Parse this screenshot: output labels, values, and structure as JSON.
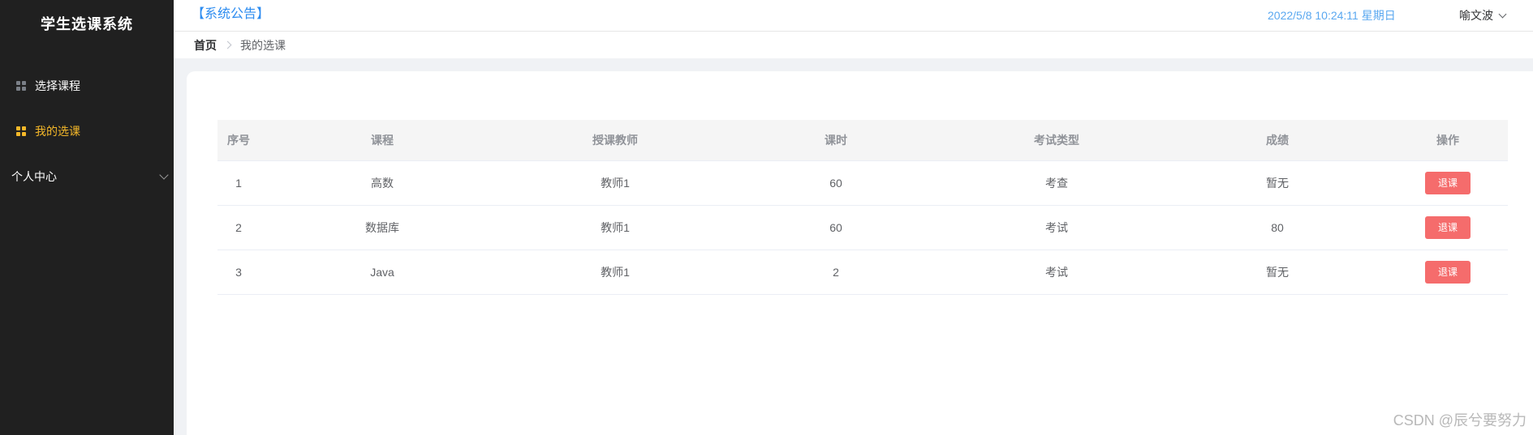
{
  "app_title": "学生选课系统",
  "sidebar": {
    "items": [
      {
        "label": "选择课程",
        "icon": "grid-icon"
      },
      {
        "label": "我的选课",
        "icon": "grid-icon",
        "active": true
      },
      {
        "label": "个人中心",
        "icon": "chevron-down-icon"
      }
    ]
  },
  "header": {
    "notice": "【系统公告】",
    "datetime": "2022/5/8 10:24:11 星期日",
    "user": "喻文波"
  },
  "breadcrumb": {
    "home": "首页",
    "current": "我的选课"
  },
  "table": {
    "columns": [
      "序号",
      "课程",
      "授课教师",
      "课时",
      "考试类型",
      "成绩",
      "操作"
    ],
    "rows": [
      {
        "idx": "1",
        "course": "高数",
        "teacher": "教师1",
        "hours": "60",
        "exam": "考查",
        "score": "暂无",
        "action": "退课"
      },
      {
        "idx": "2",
        "course": "数据库",
        "teacher": "教师1",
        "hours": "60",
        "exam": "考试",
        "score": "80",
        "action": "退课"
      },
      {
        "idx": "3",
        "course": "Java",
        "teacher": "教师1",
        "hours": "2",
        "exam": "考试",
        "score": "暂无",
        "action": "退课"
      }
    ]
  },
  "watermark": "CSDN @辰兮要努力",
  "colors": {
    "sidebar_bg": "#202020",
    "active": "#f5b829",
    "notice": "#2d8cf0",
    "danger": "#f56c6c"
  }
}
